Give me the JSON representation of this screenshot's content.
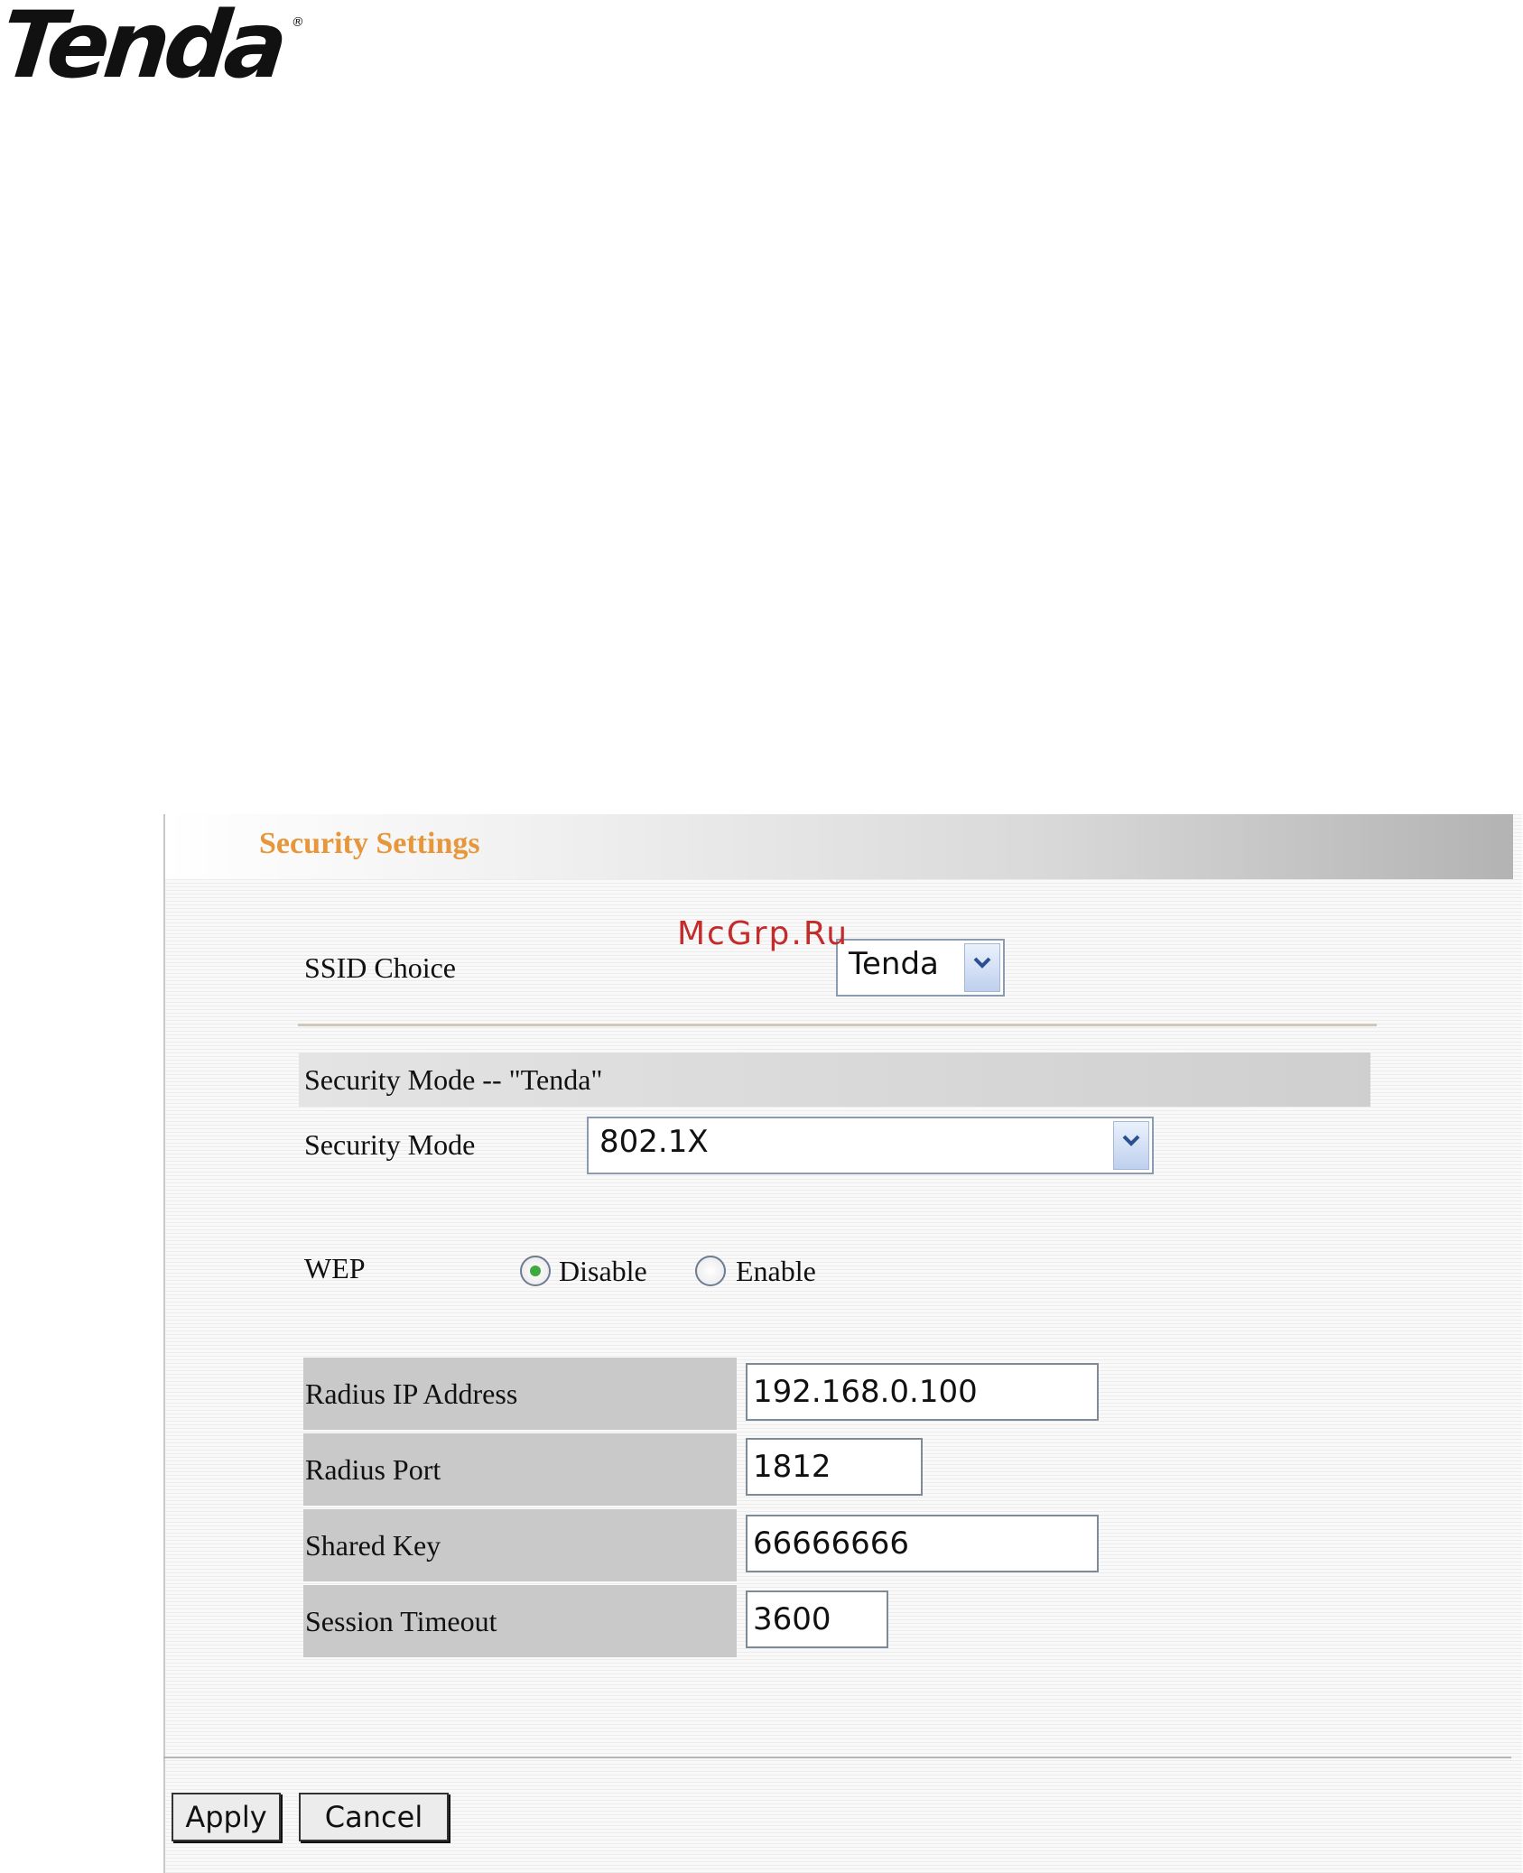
{
  "brand": {
    "logo_text": "Tenda",
    "registered_mark": "®"
  },
  "watermark": "McGrp.Ru",
  "panel": {
    "title": "Security Settings"
  },
  "ssid": {
    "label": "SSID Choice",
    "selected": "Tenda"
  },
  "security_section": {
    "header": "Security Mode -- \"Tenda\"",
    "mode_label": "Security Mode",
    "mode_selected": "802.1X"
  },
  "wep": {
    "label": "WEP",
    "options": [
      {
        "label": "Disable",
        "checked": true
      },
      {
        "label": "Enable",
        "checked": false
      }
    ]
  },
  "radius": {
    "ip_label": "Radius IP Address",
    "ip_value": "192.168.0.100",
    "port_label": "Radius Port",
    "port_value": "1812",
    "key_label": "Shared Key",
    "key_value": "66666666",
    "timeout_label": "Session Timeout",
    "timeout_value": "3600"
  },
  "buttons": {
    "apply": "Apply",
    "cancel": "Cancel"
  },
  "colors": {
    "title_orange": "#e8963a",
    "watermark_red": "#c42b2b",
    "radio_dot": "#3fa83f"
  }
}
